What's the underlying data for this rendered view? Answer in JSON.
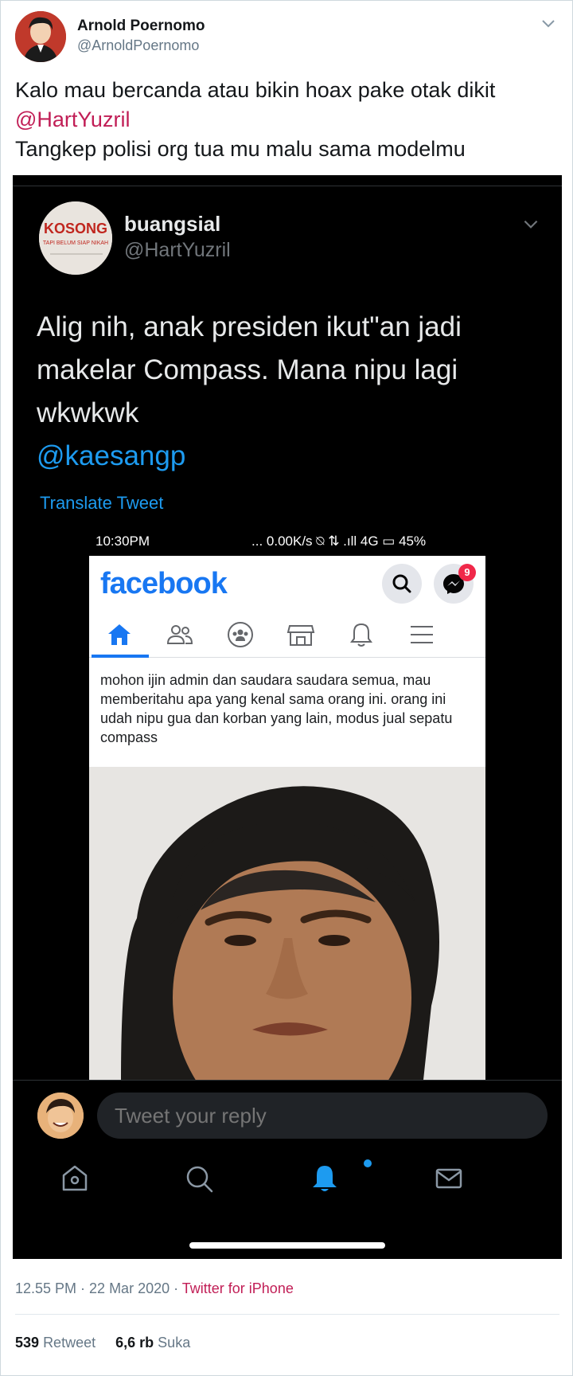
{
  "author": {
    "name": "Arnold Poernomo",
    "handle": "@ArnoldPoernomo"
  },
  "tweet": {
    "line1": "Kalo mau bercanda atau bikin hoax pake otak dikit",
    "mention": "@HartYuzril",
    "line3": "Tangkep polisi org tua mu malu sama modelmu"
  },
  "quoted": {
    "avatar_text_top": "KOSONG",
    "avatar_text_bottom": "TAPI BELUM SIAP NIKAH",
    "name": "buangsial",
    "handle": "@HartYuzril",
    "text": "Alig nih, anak presiden ikut\"an jadi makelar Compass. Mana nipu lagi wkwkwk",
    "mention": "@kaesangp",
    "translate_label": "Translate Tweet"
  },
  "phone_status": {
    "time": "10:30PM",
    "right": "... 0.00K/s ⍉ ⇅ .ıll 4G ▭ 45%"
  },
  "facebook": {
    "logo": "facebook",
    "badge_count": "9",
    "post_text": "mohon ijin admin dan saudara saudara semua, mau memberitahu apa yang kenal sama orang ini. orang ini udah nipu gua dan korban yang lain, modus jual sepatu compass",
    "tabs": [
      "home-icon",
      "friends-icon",
      "groups-icon",
      "marketplace-icon",
      "bell-icon",
      "menu-icon"
    ]
  },
  "reply": {
    "placeholder": "Tweet your reply"
  },
  "footer": {
    "timestamp": "12.55 PM · 22 Mar 2020 · ",
    "source": "Twitter for iPhone",
    "retweet_count": "539",
    "retweet_label": "Retweet",
    "like_count": "6,6 rb",
    "like_label": "Suka"
  },
  "colors": {
    "twitter_blue": "#1d9bf0",
    "mention_pink": "#c11e56",
    "facebook_blue": "#1877f2",
    "notification_red": "#f02849"
  }
}
